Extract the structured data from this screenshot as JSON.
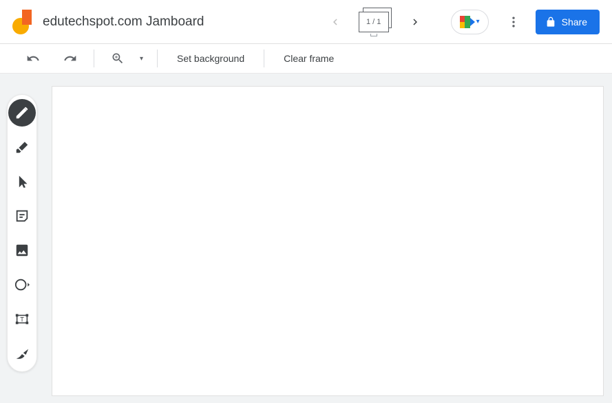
{
  "header": {
    "title": "edutechspot.com Jamboard",
    "frame_indicator": "1 / 1",
    "share_label": "Share"
  },
  "toolbar": {
    "set_background": "Set background",
    "clear_frame": "Clear frame"
  },
  "tools": {
    "pen": "Pen",
    "eraser": "Eraser",
    "select": "Select",
    "sticky": "Sticky note",
    "image": "Add image",
    "shape": "Circle",
    "textbox": "Text box",
    "laser": "Laser"
  },
  "colors": {
    "accent": "#1a73e8",
    "toolbar_icon": "#5f6368",
    "canvas_bg": "#f1f3f4"
  }
}
